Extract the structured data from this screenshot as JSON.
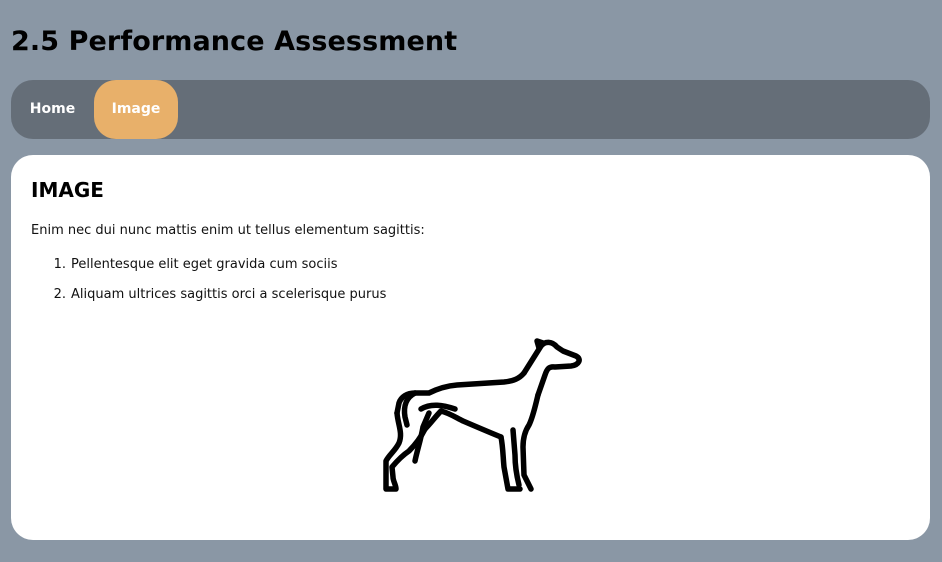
{
  "page": {
    "title": "2.5 Performance Assessment"
  },
  "nav": {
    "items": [
      {
        "label": "Home",
        "active": false
      },
      {
        "label": "Image",
        "active": true
      }
    ],
    "bar_color": "#656e78",
    "active_color": "#e8b06a"
  },
  "content": {
    "heading": "IMAGE",
    "intro": "Enim nec dui nunc mattis enim ut tellus elementum sagittis:",
    "list": [
      {
        "number": "1.",
        "text": "Pellentesque elit eget gravida cum sociis"
      },
      {
        "number": "2.",
        "text": "Aliquam ultrices sagittis orci a scelerisque purus"
      }
    ],
    "image_icon": "greyhound-dog-icon"
  },
  "colors": {
    "background": "#8a97a5",
    "card": "#ffffff"
  }
}
